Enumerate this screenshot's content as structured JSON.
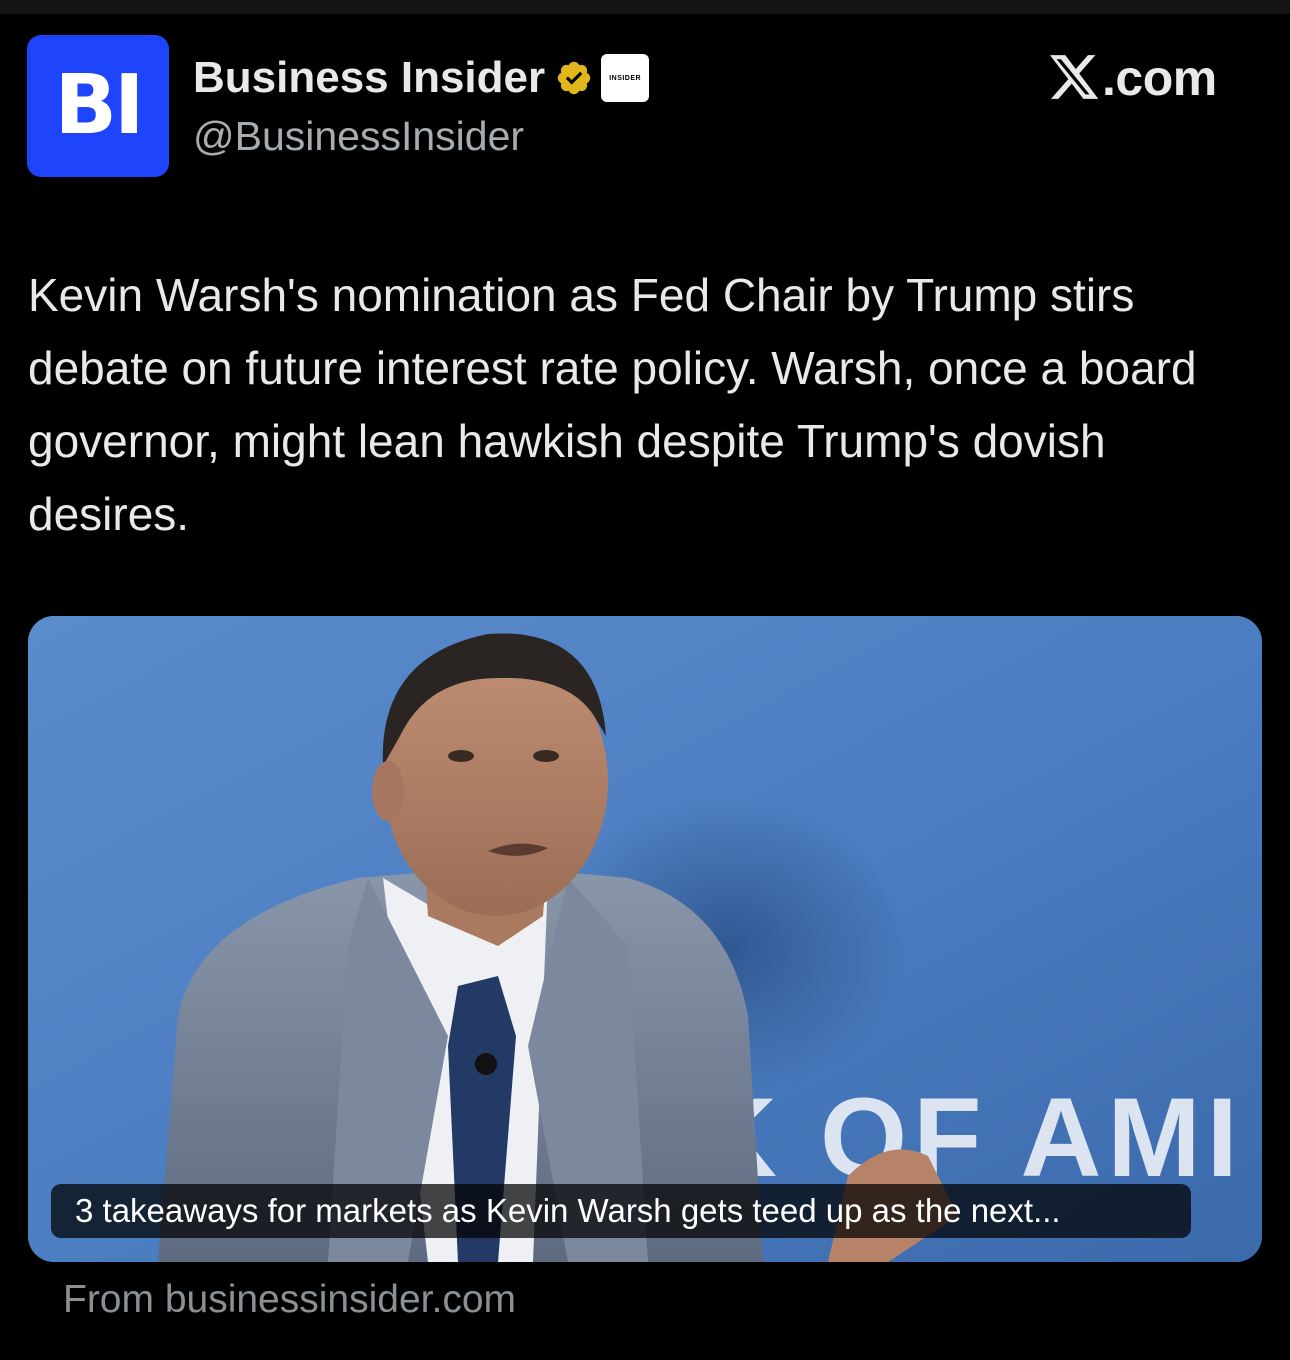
{
  "account": {
    "avatar_text": "BI",
    "display_name": "Business Insider",
    "handle": "@BusinessInsider",
    "affiliate_badge_text": "INSIDER",
    "verified_icon": "verified-gold-badge-icon"
  },
  "brand": {
    "site": ".com",
    "logo_icon": "x-logo-icon"
  },
  "post": {
    "text": "Kevin Warsh's nomination as Fed Chair by Trump stirs debate on future interest rate policy. Warsh, once a board governor, might lean hawkish despite Trump's dovish desires."
  },
  "link_card": {
    "caption": "3 takeaways for markets as Kevin Warsh gets teed up as the next...",
    "backdrop_text": "K OF AMI",
    "source": "From businessinsider.com"
  },
  "colors": {
    "background": "#000000",
    "avatar_blue": "#1f45fc",
    "verified_gold": "#e2b719",
    "text_primary": "#e7e9ea",
    "text_secondary": "#a7acb0"
  }
}
